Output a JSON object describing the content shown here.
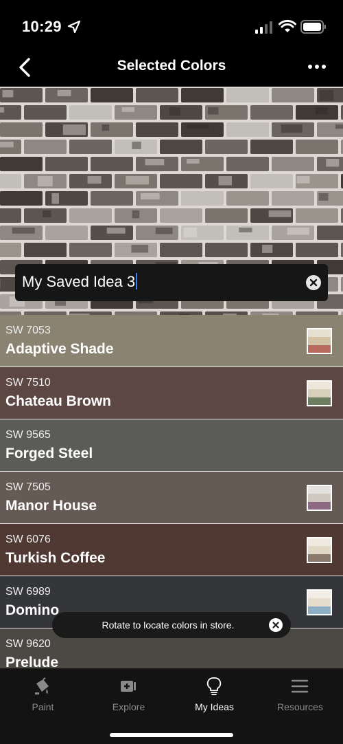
{
  "status_bar": {
    "time": "10:29"
  },
  "nav": {
    "title": "Selected Colors"
  },
  "idea_name": {
    "value": "My Saved Idea 3"
  },
  "colors": [
    {
      "code": "SW 7053",
      "name": "Adaptive Shade",
      "bg": "#8a8372",
      "swatch": [
        "#e6e0d3",
        "#d3c3a4",
        "#b86a5e"
      ]
    },
    {
      "code": "SW 7510",
      "name": "Chateau Brown",
      "bg": "#5c4742",
      "swatch": [
        "#ece7da",
        "#d8cfba",
        "#6c7c5e"
      ]
    },
    {
      "code": "SW 9565",
      "name": "Forged Steel",
      "bg": "#5b5b58",
      "swatch": null
    },
    {
      "code": "SW 7505",
      "name": "Manor House",
      "bg": "#665a54",
      "swatch": [
        "#e3e1dd",
        "#cfc8c0",
        "#8e6a82"
      ]
    },
    {
      "code": "SW 6076",
      "name": "Turkish Coffee",
      "bg": "#4f3932",
      "swatch": [
        "#efeae0",
        "#e0d7c4",
        "#8a7a6e"
      ]
    },
    {
      "code": "SW 6989",
      "name": "Domino",
      "bg": "#353639",
      "swatch": [
        "#f1ece4",
        "#e5dccd",
        "#8fb0c4"
      ]
    },
    {
      "code": "SW 9620",
      "name": "Prelude",
      "bg": "#4c4844",
      "swatch": null
    }
  ],
  "toast": {
    "text": "Rotate to locate colors in store."
  },
  "tabs": [
    {
      "label": "Paint",
      "icon": "paint-bucket-icon",
      "active": false
    },
    {
      "label": "Explore",
      "icon": "explore-icon",
      "active": false
    },
    {
      "label": "My Ideas",
      "icon": "lightbulb-icon",
      "active": true
    },
    {
      "label": "Resources",
      "icon": "menu-lines-icon",
      "active": false
    }
  ]
}
